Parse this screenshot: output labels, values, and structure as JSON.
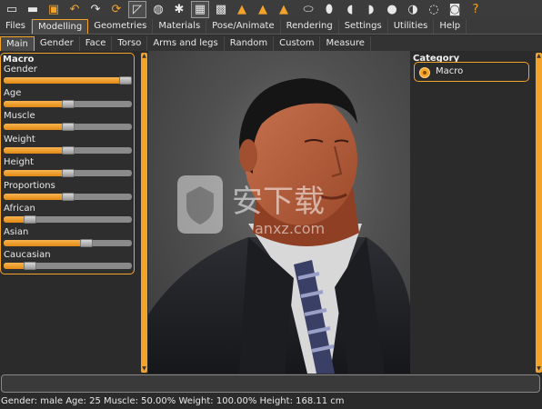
{
  "toolbar": {
    "icons": [
      "file-icon",
      "save-icon",
      "export-icon",
      "undo-icon",
      "redo-icon",
      "reset-icon",
      "wireframe-icon",
      "smooth-icon",
      "pose-icon",
      "grid-icon",
      "checker-icon",
      "front-view-icon",
      "back-view-icon",
      "side-view-icon",
      "face-icon",
      "head-icon",
      "left-icon",
      "right-icon",
      "top-icon",
      "bottom-icon",
      "reset-camera-icon",
      "screenshot-icon",
      "help-icon"
    ]
  },
  "tabs": [
    "Files",
    "Modelling",
    "Geometries",
    "Materials",
    "Pose/Animate",
    "Rendering",
    "Settings",
    "Utilities",
    "Help"
  ],
  "active_tab": "Modelling",
  "subtabs": [
    "Main",
    "Gender",
    "Face",
    "Torso",
    "Arms and legs",
    "Random",
    "Custom",
    "Measure"
  ],
  "active_subtab": "Main",
  "left_panel": {
    "title": "Macro",
    "sliders": [
      {
        "label": "Gender",
        "value": 1.0
      },
      {
        "label": "Age",
        "value": 0.5
      },
      {
        "label": "Muscle",
        "value": 0.5
      },
      {
        "label": "Weight",
        "value": 0.5
      },
      {
        "label": "Height",
        "value": 0.5
      },
      {
        "label": "Proportions",
        "value": 0.5
      },
      {
        "label": "African",
        "value": 0.17
      },
      {
        "label": "Asian",
        "value": 0.66
      },
      {
        "label": "Caucasian",
        "value": 0.17
      }
    ]
  },
  "right_panel": {
    "title": "Category",
    "option": "Macro"
  },
  "status": "Gender: male Age: 25 Muscle: 50.00% Weight: 100.00% Height: 168.11 cm",
  "watermark": {
    "text": "安下载",
    "sub": "anxz.com"
  },
  "colors": {
    "accent": "#f4a32a",
    "background": "#2b2b2b"
  }
}
